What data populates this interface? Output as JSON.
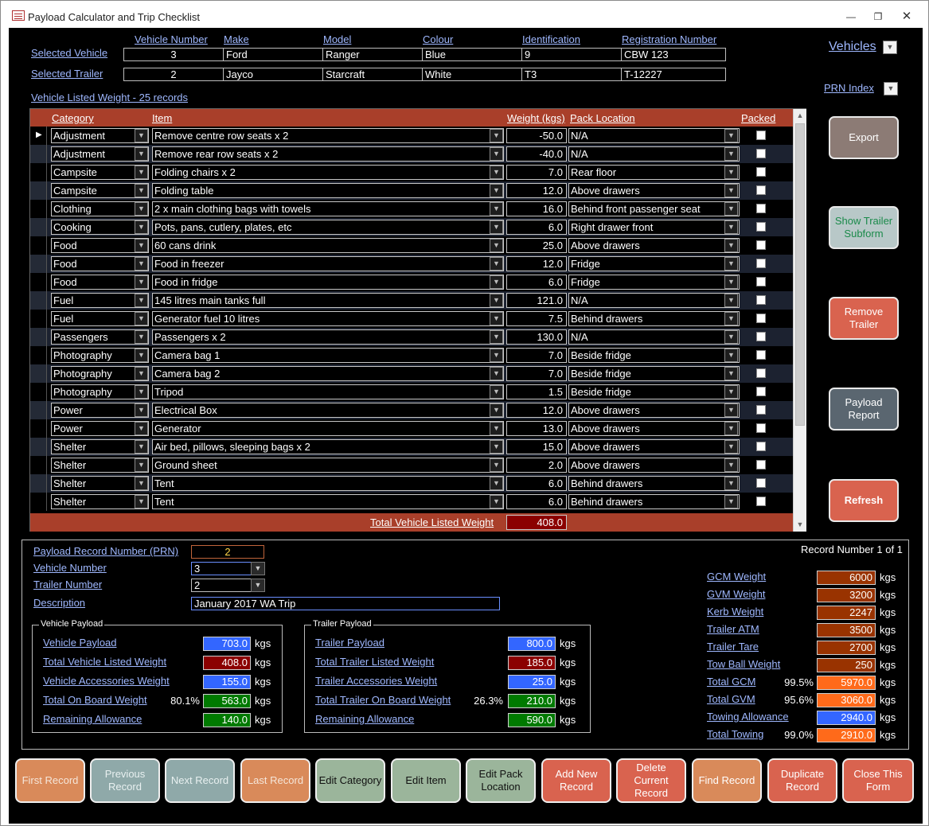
{
  "window": {
    "title": "Payload Calculator and Trip Checklist"
  },
  "header": {
    "col_vehicle_number": "Vehicle Number",
    "col_make": "Make",
    "col_model": "Model",
    "col_colour": "Colour",
    "col_identification": "Identification",
    "col_registration": "Registration Number",
    "selected_vehicle_label": "Selected Vehicle",
    "selected_trailer_label": "Selected Trailer",
    "vehicle": {
      "number": "3",
      "make": "Ford",
      "model": "Ranger",
      "colour": "Blue",
      "identification": "9",
      "registration": "CBW 123"
    },
    "trailer": {
      "number": "2",
      "make": "Jayco",
      "model": "Starcraft",
      "colour": "White",
      "identification": "T3",
      "registration": "T-12227"
    },
    "vehicles_label": "Vehicles",
    "prn_index_label": "PRN Index",
    "listed_weight_link": "Vehicle Listed Weight - 25 records"
  },
  "grid": {
    "headers": {
      "category": "Category",
      "item": "Item",
      "weight": "Weight (kgs)",
      "pack_location": "Pack Location",
      "packed": "Packed"
    },
    "rows": [
      {
        "category": "Adjustment",
        "item": "Remove centre row seats x 2",
        "weight": "-50.0",
        "location": "N/A"
      },
      {
        "category": "Adjustment",
        "item": "Remove rear row seats x 2",
        "weight": "-40.0",
        "location": "N/A"
      },
      {
        "category": "Campsite",
        "item": "Folding chairs x 2",
        "weight": "7.0",
        "location": "Rear floor"
      },
      {
        "category": "Campsite",
        "item": "Folding table",
        "weight": "12.0",
        "location": "Above drawers"
      },
      {
        "category": "Clothing",
        "item": "2 x main clothing bags with towels",
        "weight": "16.0",
        "location": "Behind front passenger seat"
      },
      {
        "category": "Cooking",
        "item": "Pots, pans, cutlery, plates, etc",
        "weight": "6.0",
        "location": "Right drawer front"
      },
      {
        "category": "Food",
        "item": "60 cans drink",
        "weight": "25.0",
        "location": "Above drawers"
      },
      {
        "category": "Food",
        "item": "Food in freezer",
        "weight": "12.0",
        "location": "Fridge"
      },
      {
        "category": "Food",
        "item": "Food in fridge",
        "weight": "6.0",
        "location": "Fridge"
      },
      {
        "category": "Fuel",
        "item": "145 litres main tanks full",
        "weight": "121.0",
        "location": "N/A"
      },
      {
        "category": "Fuel",
        "item": "Generator fuel 10 litres",
        "weight": "7.5",
        "location": "Behind drawers"
      },
      {
        "category": "Passengers",
        "item": "Passengers x 2",
        "weight": "130.0",
        "location": "N/A"
      },
      {
        "category": "Photography",
        "item": "Camera bag 1",
        "weight": "7.0",
        "location": "Beside fridge"
      },
      {
        "category": "Photography",
        "item": "Camera bag 2",
        "weight": "7.0",
        "location": "Beside fridge"
      },
      {
        "category": "Photography",
        "item": "Tripod",
        "weight": "1.5",
        "location": "Beside fridge"
      },
      {
        "category": "Power",
        "item": "Electrical Box",
        "weight": "12.0",
        "location": "Above drawers"
      },
      {
        "category": "Power",
        "item": "Generator",
        "weight": "13.0",
        "location": "Above drawers"
      },
      {
        "category": "Shelter",
        "item": "Air bed, pillows, sleeping bags x 2",
        "weight": "15.0",
        "location": "Above drawers"
      },
      {
        "category": "Shelter",
        "item": "Ground sheet",
        "weight": "2.0",
        "location": "Above drawers"
      },
      {
        "category": "Shelter",
        "item": "Tent",
        "weight": "6.0",
        "location": "Behind drawers"
      },
      {
        "category": "Shelter",
        "item": "Tent",
        "weight": "6.0",
        "location": "Behind drawers"
      }
    ],
    "footer_label": "Total Vehicle Listed Weight",
    "footer_total": "408.0"
  },
  "side_buttons": {
    "export": "Export",
    "show_trailer": "Show Trailer Subform",
    "remove_trailer": "Remove Trailer",
    "payload_report": "Payload Report",
    "refresh": "Refresh"
  },
  "record": {
    "prn_label": "Payload Record Number (PRN)",
    "prn_value": "2",
    "vehicle_number_label": "Vehicle Number",
    "vehicle_number_value": "3",
    "trailer_number_label": "Trailer Number",
    "trailer_number_value": "2",
    "description_label": "Description",
    "description_value": "January 2017 WA Trip",
    "record_counter": "Record Number 1 of 1"
  },
  "vehicle_payload": {
    "group": "Vehicle Payload",
    "unit": "kgs",
    "payload_label": "Vehicle Payload",
    "payload": "703.0",
    "listed_label": "Total Vehicle Listed Weight",
    "listed": "408.0",
    "accessories_label": "Vehicle Accessories Weight",
    "accessories": "155.0",
    "onboard_label": "Total On Board Weight",
    "onboard_pct": "80.1%",
    "onboard": "563.0",
    "remaining_label": "Remaining Allowance",
    "remaining": "140.0"
  },
  "trailer_payload": {
    "group": "Trailer Payload",
    "unit": "kgs",
    "payload_label": "Trailer Payload",
    "payload": "800.0",
    "listed_label": "Total Trailer Listed Weight",
    "listed": "185.0",
    "accessories_label": "Trailer Accessories Weight",
    "accessories": "25.0",
    "onboard_label": "Total Trailer On Board Weight",
    "onboard_pct": "26.3%",
    "onboard": "210.0",
    "remaining_label": "Remaining Allowance",
    "remaining": "590.0"
  },
  "weights": {
    "unit": "kgs",
    "gcm_label": "GCM Weight",
    "gcm": "6000",
    "gvm_label": "GVM Weight",
    "gvm": "3200",
    "kerb_label": "Kerb Weight",
    "kerb": "2247",
    "atm_label": "Trailer ATM",
    "atm": "3500",
    "tare_label": "Trailer Tare",
    "tare": "2700",
    "towball_label": "Tow Ball Weight",
    "towball": "250",
    "total_gcm_label": "Total GCM",
    "total_gcm_pct": "99.5%",
    "total_gcm": "5970.0",
    "total_gvm_label": "Total GVM",
    "total_gvm_pct": "95.6%",
    "total_gvm": "3060.0",
    "towing_allow_label": "Towing Allowance",
    "towing_allow": "2940.0",
    "total_towing_label": "Total Towing",
    "total_towing_pct": "99.0%",
    "total_towing": "2910.0"
  },
  "nav": {
    "first": "First Record",
    "previous": "Previous Record",
    "next": "Next Record",
    "last": "Last Record",
    "edit_category": "Edit Category",
    "edit_item": "Edit Item",
    "edit_pack": "Edit Pack Location",
    "add_new": "Add New Record",
    "delete": "Delete Current Record",
    "find": "Find Record",
    "duplicate": "Duplicate Record",
    "close": "Close This Form"
  },
  "colors": {
    "header_bar": "#a93f2a",
    "blue_value": "#3366ff",
    "red_value": "#8b0000",
    "green_value": "#007a00",
    "orange_value": "#ff6a1a",
    "brown_value": "#993300"
  }
}
